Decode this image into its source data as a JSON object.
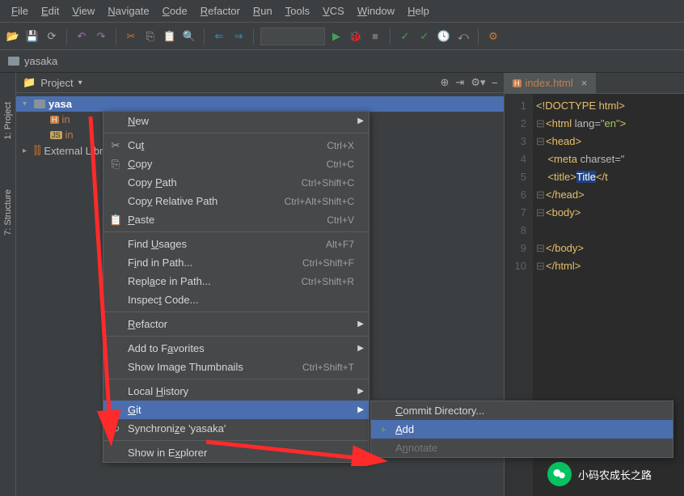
{
  "menubar": [
    "File",
    "Edit",
    "View",
    "Navigate",
    "Code",
    "Refactor",
    "Run",
    "Tools",
    "VCS",
    "Window",
    "Help"
  ],
  "breadcrumb": {
    "project": "yasaka"
  },
  "sidebar": {
    "tabs": [
      "1: Project",
      "7: Structure"
    ]
  },
  "project_panel": {
    "title": "Project",
    "tree": {
      "root": "yasa",
      "child1_prefix": "in",
      "child2_prefix": "in",
      "external": "External Libraries"
    }
  },
  "editor": {
    "tab": "index.html",
    "lines": [
      {
        "n": "1",
        "t": "<!DOCTYPE html>",
        "cls": "doctype"
      },
      {
        "n": "2",
        "t": "<html lang=\"en\">",
        "cls": "html-open"
      },
      {
        "n": "3",
        "t": "<head>",
        "cls": "head-open"
      },
      {
        "n": "4",
        "t": "<meta charset=",
        "cls": "meta"
      },
      {
        "n": "5",
        "t": "<title>Title</t",
        "cls": "title"
      },
      {
        "n": "6",
        "t": "</head>",
        "cls": "head-close"
      },
      {
        "n": "7",
        "t": "<body>",
        "cls": "body-open"
      },
      {
        "n": "8",
        "t": "",
        "cls": "blank"
      },
      {
        "n": "9",
        "t": "</body>",
        "cls": "body-close"
      },
      {
        "n": "10",
        "t": "</html>",
        "cls": "html-close"
      }
    ]
  },
  "context_menu": {
    "items": [
      {
        "label": "New",
        "shortcut": "",
        "arrow": true
      },
      {
        "divider": true
      },
      {
        "label": "Cut",
        "shortcut": "Ctrl+X",
        "icon": "✂"
      },
      {
        "label": "Copy",
        "shortcut": "Ctrl+C",
        "icon": "⎘"
      },
      {
        "label": "Copy Path",
        "shortcut": "Ctrl+Shift+C"
      },
      {
        "label": "Copy Relative Path",
        "shortcut": "Ctrl+Alt+Shift+C"
      },
      {
        "label": "Paste",
        "shortcut": "Ctrl+V",
        "icon": "📋"
      },
      {
        "divider": true
      },
      {
        "label": "Find Usages",
        "shortcut": "Alt+F7"
      },
      {
        "label": "Find in Path...",
        "shortcut": "Ctrl+Shift+F"
      },
      {
        "label": "Replace in Path...",
        "shortcut": "Ctrl+Shift+R"
      },
      {
        "label": "Inspect Code...",
        "shortcut": ""
      },
      {
        "divider": true
      },
      {
        "label": "Refactor",
        "shortcut": "",
        "arrow": true
      },
      {
        "divider": true
      },
      {
        "label": "Add to Favorites",
        "shortcut": "",
        "arrow": true
      },
      {
        "label": "Show Image Thumbnails",
        "shortcut": "Ctrl+Shift+T"
      },
      {
        "divider": true
      },
      {
        "label": "Local History",
        "shortcut": "",
        "arrow": true
      },
      {
        "label": "Git",
        "shortcut": "",
        "arrow": true,
        "selected": true
      },
      {
        "label": "Synchronize 'yasaka'",
        "shortcut": "",
        "icon": "↻"
      },
      {
        "divider": true
      },
      {
        "label": "Show in Explorer",
        "shortcut": ""
      }
    ],
    "submenu": [
      {
        "label": "Commit Directory...",
        "shortcut": ""
      },
      {
        "label": "Add",
        "shortcut": "",
        "icon": "+",
        "selected": true
      },
      {
        "label": "Annotate",
        "shortcut": "",
        "disabled": true
      }
    ]
  },
  "watermark": "小码农成长之路"
}
